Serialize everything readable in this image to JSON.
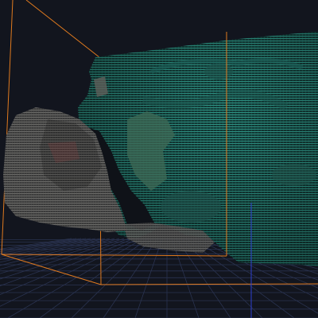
{
  "viewer": {
    "scene": "point-cloud",
    "background_color": "#12151e",
    "floor_grid_color": "#2a3350",
    "bounding_box_color": "#e07a1f",
    "point_cloud_color": "#2f9a8a",
    "rock_color": "#6a6a68",
    "z_axis_color": "#2f3fd0"
  }
}
